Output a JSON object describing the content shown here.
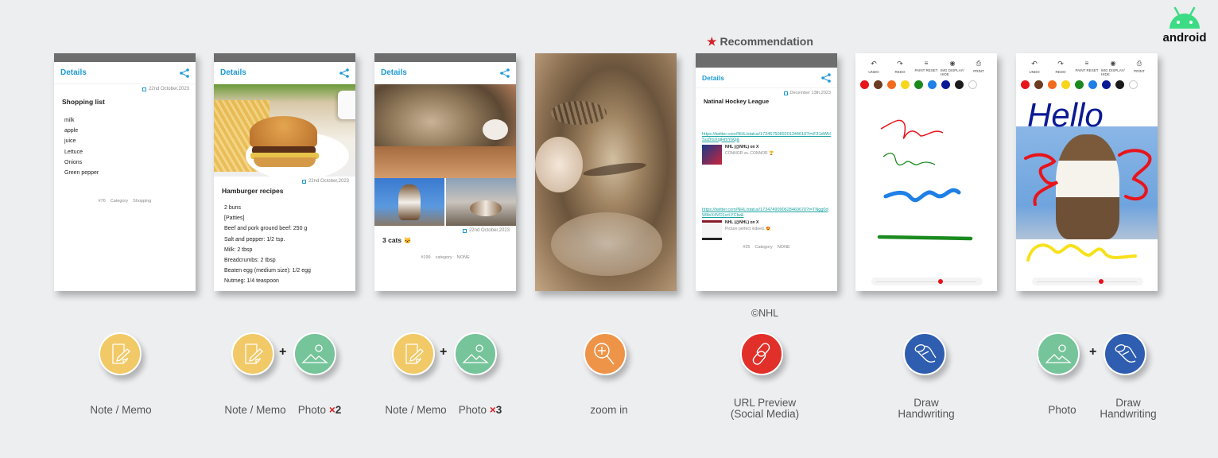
{
  "brand": {
    "logo_text": "android",
    "logo_color": "#3ddc84"
  },
  "recommendation": {
    "label": "Recommendation",
    "star": "★"
  },
  "copyright": "©NHL",
  "screens": {
    "memo": {
      "header": "Details",
      "date": "22nd October,2023",
      "title": "Shopping list",
      "items": [
        "milk",
        "apple",
        "juice",
        "Lettuce",
        "Onions",
        "Green pepper"
      ],
      "footer": {
        "id": "#76",
        "category_label": "Category",
        "category": "Shopping"
      }
    },
    "recipe": {
      "header": "Details",
      "date": "22nd October,2023",
      "title": "Hamburger recipes",
      "items": [
        "2 buns",
        "[Patties]",
        "Beef and pork ground beef: 250 g",
        "Salt and pepper: 1/2 tsp.",
        "Milk: 2 tbsp",
        "Breadcrumbs: 2 tbsp",
        "Beaten egg (medium size): 1/2 egg",
        "Nutmeg: 1/4 teaspoon"
      ]
    },
    "cats": {
      "header": "Details",
      "date": "22nd October,2023",
      "title": "3 cats",
      "title_emoji": "🐱",
      "footer": {
        "id": "#199",
        "category_label": "category",
        "category": "NONE"
      }
    },
    "nhl": {
      "header": "Details",
      "date": "December 13th,2023",
      "title": "Natinal Hockey League",
      "links": [
        {
          "url": "https://twitter.com/NHL/status/1734575089201344610?t=iF31dWHSuZhsXqjHmY6Q&",
          "card_title": "NHL (@NHL) on X",
          "card_text": "CONNOR vs. CONNOR 🏆"
        },
        {
          "url": "https://twitter.com/NHL/status/1734749090628460670?t=TNgg0dW8eX4VD1vrLYClw&",
          "card_title": "NHL (@NHL) on X",
          "card_text": "Picture perfect indeed. 😍"
        }
      ],
      "footer": {
        "id": "#25",
        "category_label": "Category",
        "category": "NONE"
      }
    },
    "draw": {
      "tools": [
        "UNDO",
        "REDO",
        "PAINT RESET",
        "IMG DISPLAY/ HIDE",
        "PRINT"
      ],
      "palette": [
        "#e8141b",
        "#6b3c22",
        "#f26a1b",
        "#f7d61b",
        "#1a8a1e",
        "#1e7fe6",
        "#0a1a94",
        "#1b1b1b",
        "#ffffff"
      ],
      "brush_size": 0.65
    },
    "draw_photo": {
      "text": "Hello",
      "brush_size": 0.65
    }
  },
  "features": [
    {
      "labels": [
        "Note / Memo"
      ]
    },
    {
      "labels": [
        "Note / Memo",
        "Photo"
      ],
      "photo_count": "2"
    },
    {
      "labels": [
        "Note / Memo",
        "Photo"
      ],
      "photo_count": "3"
    },
    {
      "labels": [
        "zoom in"
      ]
    },
    {
      "labels": [
        "URL Preview",
        "(Social Media)"
      ]
    },
    {
      "labels": [
        "Draw",
        "Handwriting"
      ]
    },
    {
      "labels": [
        "Photo",
        "Draw",
        "Handwriting"
      ]
    }
  ],
  "times_symbol": "×",
  "plus_symbol": "+",
  "colors": {
    "memo": "#f2c967",
    "photo": "#76c49a",
    "zoom": "#ee9449",
    "link": "#e1302a",
    "draw": "#2f5eb0"
  }
}
